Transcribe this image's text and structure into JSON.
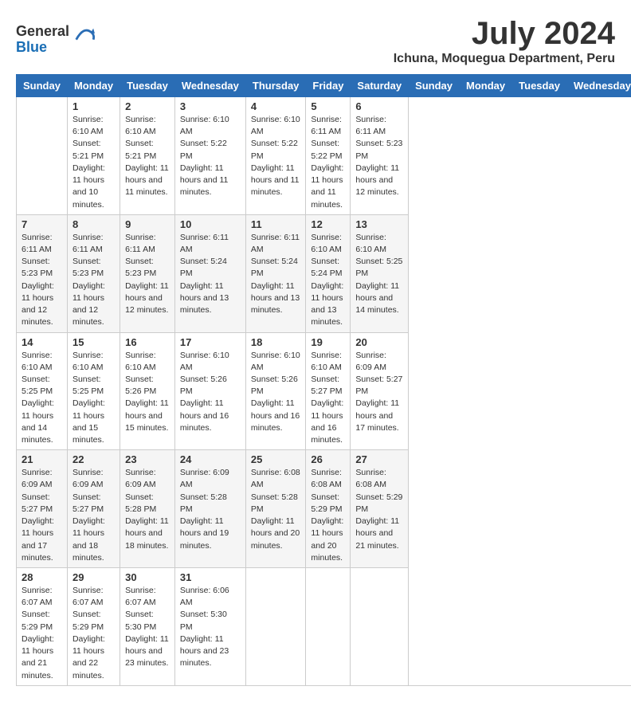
{
  "header": {
    "logo_general": "General",
    "logo_blue": "Blue",
    "month_year": "July 2024",
    "location": "Ichuna, Moquegua Department, Peru"
  },
  "days_of_week": [
    "Sunday",
    "Monday",
    "Tuesday",
    "Wednesday",
    "Thursday",
    "Friday",
    "Saturday"
  ],
  "weeks": [
    [
      {
        "day": "",
        "sunrise": "",
        "sunset": "",
        "daylight": ""
      },
      {
        "day": "1",
        "sunrise": "Sunrise: 6:10 AM",
        "sunset": "Sunset: 5:21 PM",
        "daylight": "Daylight: 11 hours and 10 minutes."
      },
      {
        "day": "2",
        "sunrise": "Sunrise: 6:10 AM",
        "sunset": "Sunset: 5:21 PM",
        "daylight": "Daylight: 11 hours and 11 minutes."
      },
      {
        "day": "3",
        "sunrise": "Sunrise: 6:10 AM",
        "sunset": "Sunset: 5:22 PM",
        "daylight": "Daylight: 11 hours and 11 minutes."
      },
      {
        "day": "4",
        "sunrise": "Sunrise: 6:10 AM",
        "sunset": "Sunset: 5:22 PM",
        "daylight": "Daylight: 11 hours and 11 minutes."
      },
      {
        "day": "5",
        "sunrise": "Sunrise: 6:11 AM",
        "sunset": "Sunset: 5:22 PM",
        "daylight": "Daylight: 11 hours and 11 minutes."
      },
      {
        "day": "6",
        "sunrise": "Sunrise: 6:11 AM",
        "sunset": "Sunset: 5:23 PM",
        "daylight": "Daylight: 11 hours and 12 minutes."
      }
    ],
    [
      {
        "day": "7",
        "sunrise": "Sunrise: 6:11 AM",
        "sunset": "Sunset: 5:23 PM",
        "daylight": "Daylight: 11 hours and 12 minutes."
      },
      {
        "day": "8",
        "sunrise": "Sunrise: 6:11 AM",
        "sunset": "Sunset: 5:23 PM",
        "daylight": "Daylight: 11 hours and 12 minutes."
      },
      {
        "day": "9",
        "sunrise": "Sunrise: 6:11 AM",
        "sunset": "Sunset: 5:23 PM",
        "daylight": "Daylight: 11 hours and 12 minutes."
      },
      {
        "day": "10",
        "sunrise": "Sunrise: 6:11 AM",
        "sunset": "Sunset: 5:24 PM",
        "daylight": "Daylight: 11 hours and 13 minutes."
      },
      {
        "day": "11",
        "sunrise": "Sunrise: 6:11 AM",
        "sunset": "Sunset: 5:24 PM",
        "daylight": "Daylight: 11 hours and 13 minutes."
      },
      {
        "day": "12",
        "sunrise": "Sunrise: 6:10 AM",
        "sunset": "Sunset: 5:24 PM",
        "daylight": "Daylight: 11 hours and 13 minutes."
      },
      {
        "day": "13",
        "sunrise": "Sunrise: 6:10 AM",
        "sunset": "Sunset: 5:25 PM",
        "daylight": "Daylight: 11 hours and 14 minutes."
      }
    ],
    [
      {
        "day": "14",
        "sunrise": "Sunrise: 6:10 AM",
        "sunset": "Sunset: 5:25 PM",
        "daylight": "Daylight: 11 hours and 14 minutes."
      },
      {
        "day": "15",
        "sunrise": "Sunrise: 6:10 AM",
        "sunset": "Sunset: 5:25 PM",
        "daylight": "Daylight: 11 hours and 15 minutes."
      },
      {
        "day": "16",
        "sunrise": "Sunrise: 6:10 AM",
        "sunset": "Sunset: 5:26 PM",
        "daylight": "Daylight: 11 hours and 15 minutes."
      },
      {
        "day": "17",
        "sunrise": "Sunrise: 6:10 AM",
        "sunset": "Sunset: 5:26 PM",
        "daylight": "Daylight: 11 hours and 16 minutes."
      },
      {
        "day": "18",
        "sunrise": "Sunrise: 6:10 AM",
        "sunset": "Sunset: 5:26 PM",
        "daylight": "Daylight: 11 hours and 16 minutes."
      },
      {
        "day": "19",
        "sunrise": "Sunrise: 6:10 AM",
        "sunset": "Sunset: 5:27 PM",
        "daylight": "Daylight: 11 hours and 16 minutes."
      },
      {
        "day": "20",
        "sunrise": "Sunrise: 6:09 AM",
        "sunset": "Sunset: 5:27 PM",
        "daylight": "Daylight: 11 hours and 17 minutes."
      }
    ],
    [
      {
        "day": "21",
        "sunrise": "Sunrise: 6:09 AM",
        "sunset": "Sunset: 5:27 PM",
        "daylight": "Daylight: 11 hours and 17 minutes."
      },
      {
        "day": "22",
        "sunrise": "Sunrise: 6:09 AM",
        "sunset": "Sunset: 5:27 PM",
        "daylight": "Daylight: 11 hours and 18 minutes."
      },
      {
        "day": "23",
        "sunrise": "Sunrise: 6:09 AM",
        "sunset": "Sunset: 5:28 PM",
        "daylight": "Daylight: 11 hours and 18 minutes."
      },
      {
        "day": "24",
        "sunrise": "Sunrise: 6:09 AM",
        "sunset": "Sunset: 5:28 PM",
        "daylight": "Daylight: 11 hours and 19 minutes."
      },
      {
        "day": "25",
        "sunrise": "Sunrise: 6:08 AM",
        "sunset": "Sunset: 5:28 PM",
        "daylight": "Daylight: 11 hours and 20 minutes."
      },
      {
        "day": "26",
        "sunrise": "Sunrise: 6:08 AM",
        "sunset": "Sunset: 5:29 PM",
        "daylight": "Daylight: 11 hours and 20 minutes."
      },
      {
        "day": "27",
        "sunrise": "Sunrise: 6:08 AM",
        "sunset": "Sunset: 5:29 PM",
        "daylight": "Daylight: 11 hours and 21 minutes."
      }
    ],
    [
      {
        "day": "28",
        "sunrise": "Sunrise: 6:07 AM",
        "sunset": "Sunset: 5:29 PM",
        "daylight": "Daylight: 11 hours and 21 minutes."
      },
      {
        "day": "29",
        "sunrise": "Sunrise: 6:07 AM",
        "sunset": "Sunset: 5:29 PM",
        "daylight": "Daylight: 11 hours and 22 minutes."
      },
      {
        "day": "30",
        "sunrise": "Sunrise: 6:07 AM",
        "sunset": "Sunset: 5:30 PM",
        "daylight": "Daylight: 11 hours and 23 minutes."
      },
      {
        "day": "31",
        "sunrise": "Sunrise: 6:06 AM",
        "sunset": "Sunset: 5:30 PM",
        "daylight": "Daylight: 11 hours and 23 minutes."
      },
      {
        "day": "",
        "sunrise": "",
        "sunset": "",
        "daylight": ""
      },
      {
        "day": "",
        "sunrise": "",
        "sunset": "",
        "daylight": ""
      },
      {
        "day": "",
        "sunrise": "",
        "sunset": "",
        "daylight": ""
      }
    ]
  ]
}
